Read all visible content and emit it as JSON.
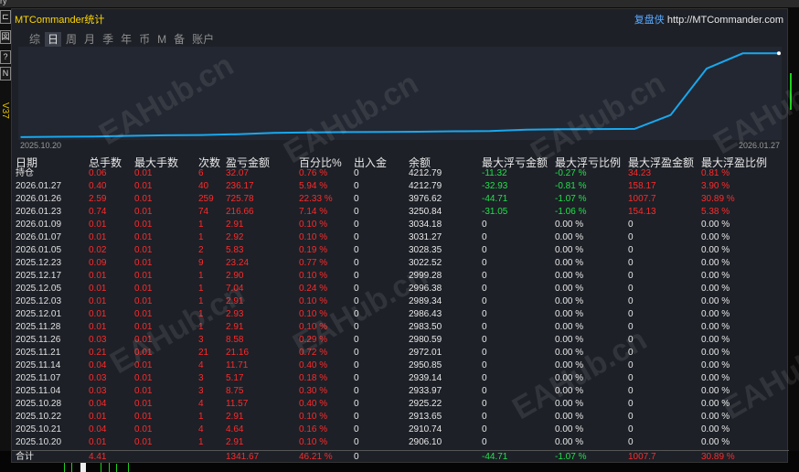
{
  "topstrip": {
    "label": "ry"
  },
  "left_tools": {
    "tool1": "⊏",
    "tool2": "図",
    "tool3": "?",
    "tool4": "N",
    "version": "V37"
  },
  "title": "MTCommander统计",
  "brand": {
    "cn": "复盘侠",
    "url": "http://MTCommander.com"
  },
  "tabs": [
    "综",
    "日",
    "周",
    "月",
    "季",
    "年",
    "币",
    "M",
    "备",
    "账户"
  ],
  "active_tab": 1,
  "chart_data": {
    "type": "line",
    "x_start_label": "2025.10.20",
    "x_end_label": "2026.01.27",
    "color": "#18a8ef",
    "x": [
      "2025.10.20",
      "2025.10.21",
      "2025.10.22",
      "2025.10.28",
      "2025.11.04",
      "2025.11.07",
      "2025.11.14",
      "2025.11.21",
      "2025.11.26",
      "2025.11.28",
      "2025.12.01",
      "2025.12.03",
      "2025.12.05",
      "2025.12.17",
      "2025.12.23",
      "2026.01.05",
      "2026.01.07",
      "2026.01.09",
      "2026.01.23",
      "2026.01.26",
      "2026.01.27",
      "持仓"
    ],
    "values": [
      2906.1,
      2910.74,
      2913.65,
      2925.22,
      2933.97,
      2939.14,
      2950.85,
      2972.01,
      2980.59,
      2983.5,
      2986.43,
      2989.34,
      2996.38,
      2999.28,
      3022.52,
      3028.35,
      3031.27,
      3034.18,
      3250.84,
      3976.62,
      4212.79,
      4212.79
    ],
    "ylim": [
      2890,
      4260
    ]
  },
  "headers": [
    "日期",
    "总手数",
    "最大手数",
    "次数",
    "盈亏金额",
    "百分比%",
    "出入金",
    "余额",
    "最大浮亏金额",
    "最大浮亏比例",
    "最大浮盈金额",
    "最大浮盈比例"
  ],
  "rows": [
    [
      "持仓",
      "0.06",
      "0.01",
      "6",
      "32.07",
      "0.76 %",
      "0",
      "4212.79",
      "-11.32",
      "-0.27 %",
      "34.23",
      "0.81 %"
    ],
    [
      "2026.01.27",
      "0.40",
      "0.01",
      "40",
      "236.17",
      "5.94 %",
      "0",
      "4212.79",
      "-32.93",
      "-0.81 %",
      "158.17",
      "3.90 %"
    ],
    [
      "2026.01.26",
      "2.59",
      "0.01",
      "259",
      "725.78",
      "22.33 %",
      "0",
      "3976.62",
      "-44.71",
      "-1.07 %",
      "1007.7",
      "30.89 %"
    ],
    [
      "2026.01.23",
      "0.74",
      "0.01",
      "74",
      "216.66",
      "7.14 %",
      "0",
      "3250.84",
      "-31.05",
      "-1.06 %",
      "154.13",
      "5.38 %"
    ],
    [
      "2026.01.09",
      "0.01",
      "0.01",
      "1",
      "2.91",
      "0.10 %",
      "0",
      "3034.18",
      "0",
      "0.00 %",
      "0",
      "0.00 %"
    ],
    [
      "2026.01.07",
      "0.01",
      "0.01",
      "1",
      "2.92",
      "0.10 %",
      "0",
      "3031.27",
      "0",
      "0.00 %",
      "0",
      "0.00 %"
    ],
    [
      "2026.01.05",
      "0.02",
      "0.01",
      "2",
      "5.83",
      "0.19 %",
      "0",
      "3028.35",
      "0",
      "0.00 %",
      "0",
      "0.00 %"
    ],
    [
      "2025.12.23",
      "0.09",
      "0.01",
      "9",
      "23.24",
      "0.77 %",
      "0",
      "3022.52",
      "0",
      "0.00 %",
      "0",
      "0.00 %"
    ],
    [
      "2025.12.17",
      "0.01",
      "0.01",
      "1",
      "2.90",
      "0.10 %",
      "0",
      "2999.28",
      "0",
      "0.00 %",
      "0",
      "0.00 %"
    ],
    [
      "2025.12.05",
      "0.01",
      "0.01",
      "1",
      "7.04",
      "0.24 %",
      "0",
      "2996.38",
      "0",
      "0.00 %",
      "0",
      "0.00 %"
    ],
    [
      "2025.12.03",
      "0.01",
      "0.01",
      "1",
      "2.91",
      "0.10 %",
      "0",
      "2989.34",
      "0",
      "0.00 %",
      "0",
      "0.00 %"
    ],
    [
      "2025.12.01",
      "0.01",
      "0.01",
      "1",
      "2.93",
      "0.10 %",
      "0",
      "2986.43",
      "0",
      "0.00 %",
      "0",
      "0.00 %"
    ],
    [
      "2025.11.28",
      "0.01",
      "0.01",
      "1",
      "2.91",
      "0.10 %",
      "0",
      "2983.50",
      "0",
      "0.00 %",
      "0",
      "0.00 %"
    ],
    [
      "2025.11.26",
      "0.03",
      "0.01",
      "3",
      "8.58",
      "0.29 %",
      "0",
      "2980.59",
      "0",
      "0.00 %",
      "0",
      "0.00 %"
    ],
    [
      "2025.11.21",
      "0.21",
      "0.01",
      "21",
      "21.16",
      "0.72 %",
      "0",
      "2972.01",
      "0",
      "0.00 %",
      "0",
      "0.00 %"
    ],
    [
      "2025.11.14",
      "0.04",
      "0.01",
      "4",
      "11.71",
      "0.40 %",
      "0",
      "2950.85",
      "0",
      "0.00 %",
      "0",
      "0.00 %"
    ],
    [
      "2025.11.07",
      "0.03",
      "0.01",
      "3",
      "5.17",
      "0.18 %",
      "0",
      "2939.14",
      "0",
      "0.00 %",
      "0",
      "0.00 %"
    ],
    [
      "2025.11.04",
      "0.03",
      "0.01",
      "3",
      "8.75",
      "0.30 %",
      "0",
      "2933.97",
      "0",
      "0.00 %",
      "0",
      "0.00 %"
    ],
    [
      "2025.10.28",
      "0.04",
      "0.01",
      "4",
      "11.57",
      "0.40 %",
      "0",
      "2925.22",
      "0",
      "0.00 %",
      "0",
      "0.00 %"
    ],
    [
      "2025.10.22",
      "0.01",
      "0.01",
      "1",
      "2.91",
      "0.10 %",
      "0",
      "2913.65",
      "0",
      "0.00 %",
      "0",
      "0.00 %"
    ],
    [
      "2025.10.21",
      "0.04",
      "0.01",
      "4",
      "4.64",
      "0.16 %",
      "0",
      "2910.74",
      "0",
      "0.00 %",
      "0",
      "0.00 %"
    ],
    [
      "2025.10.20",
      "0.01",
      "0.01",
      "1",
      "2.91",
      "0.10 %",
      "0",
      "2906.10",
      "0",
      "0.00 %",
      "0",
      "0.00 %"
    ]
  ],
  "total": {
    "label": "合计",
    "lots": "4.41",
    "max_lots": "",
    "count": "",
    "pnl": "1341.67",
    "pct": "46.21 %",
    "flow": "0",
    "balance": "",
    "max_float_loss": "-44.71",
    "max_float_loss_pct": "-1.07 %",
    "max_float_profit": "1007.7",
    "max_float_profit_pct": "30.89 %"
  },
  "watermark": "EAHub.cn",
  "colors": {
    "line": "#18a8ef",
    "negative": "#22e04a",
    "positive": "#ff2a2a",
    "title": "#ffd700"
  }
}
